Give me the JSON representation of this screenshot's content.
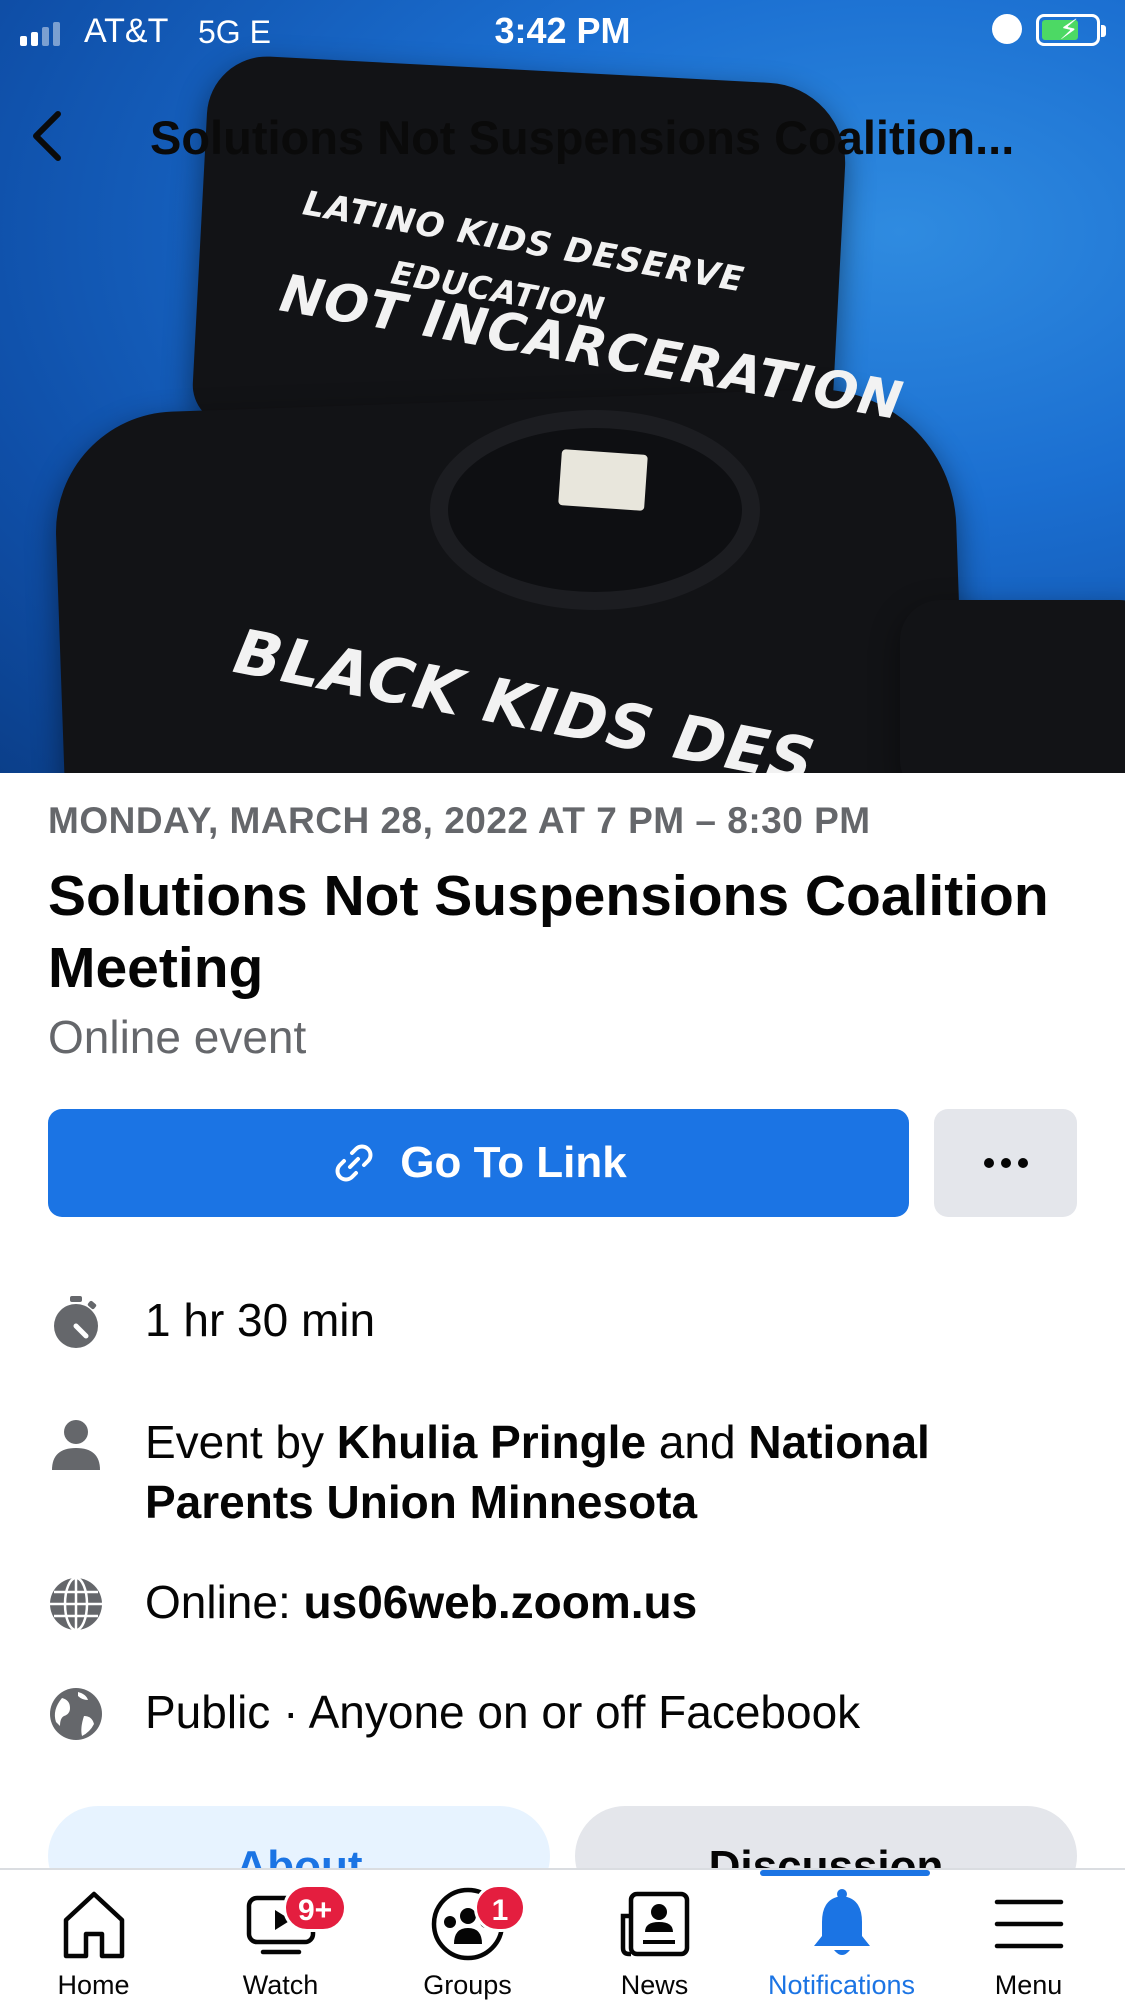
{
  "status_bar": {
    "carrier": "AT&T",
    "network": "5G E",
    "time": "3:42 PM",
    "battery_state": "charging"
  },
  "nav": {
    "title": "Solutions Not Suspensions Coalition...",
    "back_icon": "chevron-left-icon"
  },
  "cover": {
    "shirt_text_line1": "LATINO KIDS DESERVE",
    "shirt_text_line2": "EDUCATION",
    "shirt_text_line3": "NOT INCARCERATION",
    "shirt_text_line4": "BLACK KIDS DES"
  },
  "event": {
    "date": "MONDAY, MARCH 28, 2022 AT 7 PM – 8:30 PM",
    "title": "Solutions Not Suspensions Coalition Meeting",
    "subtitle": "Online event",
    "primary_action": "Go To Link",
    "more_icon": "ellipsis-icon"
  },
  "details": {
    "duration": "1 hr 30 min",
    "host_prefix": "Event by ",
    "host_1": "Khulia Pringle",
    "host_joiner": " and ",
    "host_2": "National Parents Union Minnesota",
    "online_prefix": "Online: ",
    "online_link": "us06web.zoom.us",
    "privacy": "Public · Anyone on or off Facebook"
  },
  "section_tabs": {
    "about": "About",
    "discussion": "Discussion"
  },
  "tabbar": {
    "items": [
      {
        "label": "Home",
        "icon": "home-icon",
        "badge": ""
      },
      {
        "label": "Watch",
        "icon": "watch-video-icon",
        "badge": "9+"
      },
      {
        "label": "Groups",
        "icon": "groups-icon",
        "badge": "1"
      },
      {
        "label": "News",
        "icon": "news-icon",
        "badge": ""
      },
      {
        "label": "Notifications",
        "icon": "bell-icon",
        "badge": ""
      },
      {
        "label": "Menu",
        "icon": "menu-icon",
        "badge": ""
      }
    ],
    "active": "Notifications"
  },
  "colors": {
    "accent": "#1b74e4",
    "badge": "#e41e3f",
    "secondary_text": "#65676b",
    "button_gray": "#e4e6eb"
  }
}
